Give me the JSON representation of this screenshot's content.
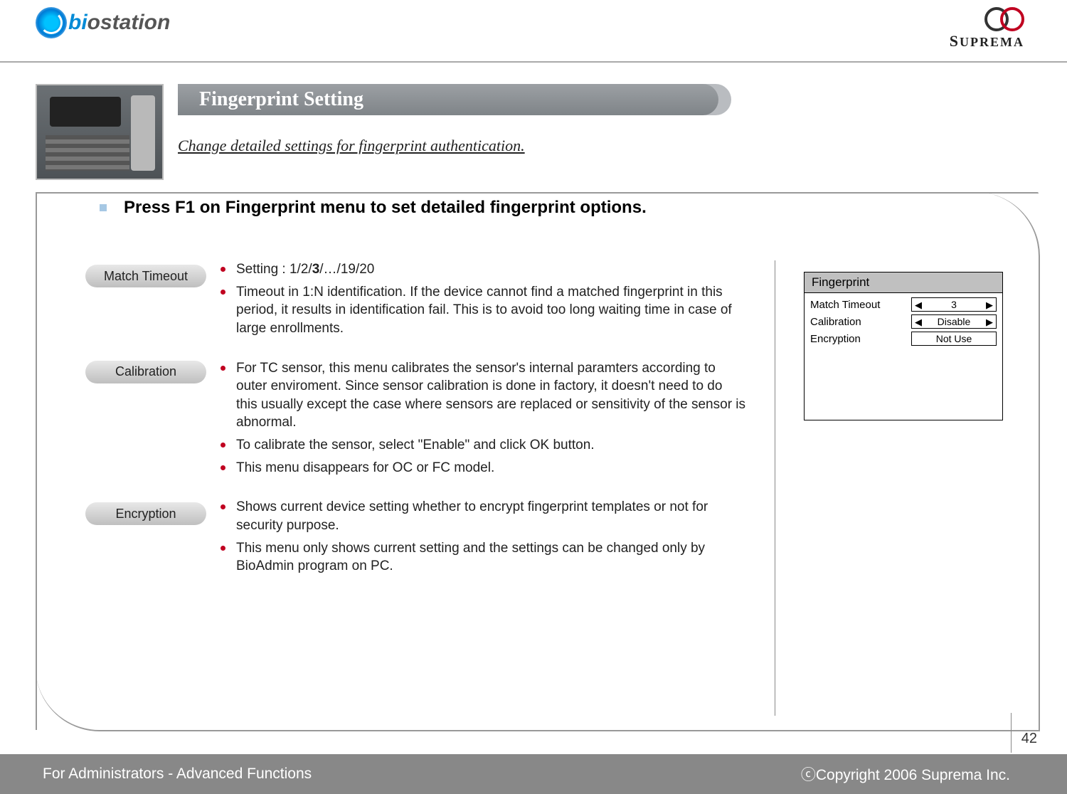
{
  "header": {
    "logo_left_text_b": "bi",
    "logo_left_text_rest": "ostation",
    "logo_right_text": "SUPREMA"
  },
  "title": {
    "main": "Fingerprint Setting",
    "sub": "Change detailed settings for fingerprint authentication."
  },
  "heading": "Press F1 on Fingerprint menu to set detailed fingerprint options.",
  "sections": {
    "match_timeout": {
      "label": "Match Timeout",
      "setting_prefix": "Setting : 1/2/",
      "setting_bold": "3",
      "setting_suffix": "/…/19/20",
      "desc": "Timeout in 1:N identification. If the device cannot find a matched fingerprint in this period, it results in identification fail. This is to avoid too long waiting time in case of large enrollments."
    },
    "calibration": {
      "label": "Calibration",
      "b1": "For TC sensor, this menu calibrates the sensor's internal paramters according to outer enviroment. Since sensor calibration is done in factory, it doesn't need to do this usually except the case where sensors are replaced or sensitivity of the sensor is abnormal.",
      "b2": "To calibrate the sensor, select \"Enable\" and click OK button.",
      "b3": "This menu disappears for OC or FC model."
    },
    "encryption": {
      "label": "Encryption",
      "b1": "Shows current device setting whether to encrypt fingerprint templates or not for security purpose.",
      "b2": "This menu only shows current setting and the settings can be changed only by BioAdmin program on PC."
    }
  },
  "lcd": {
    "title": "Fingerprint",
    "rows": [
      {
        "label": "Match Timeout",
        "value": "3",
        "arrows": true
      },
      {
        "label": "Calibration",
        "value": "Disable",
        "arrows": true
      },
      {
        "label": "Encryption",
        "value": "Not Use",
        "arrows": false
      }
    ]
  },
  "footer": {
    "left": "For Administrators - Advanced Functions",
    "right": "ⓒCopyright 2006 Suprema Inc."
  },
  "page_number": "42"
}
